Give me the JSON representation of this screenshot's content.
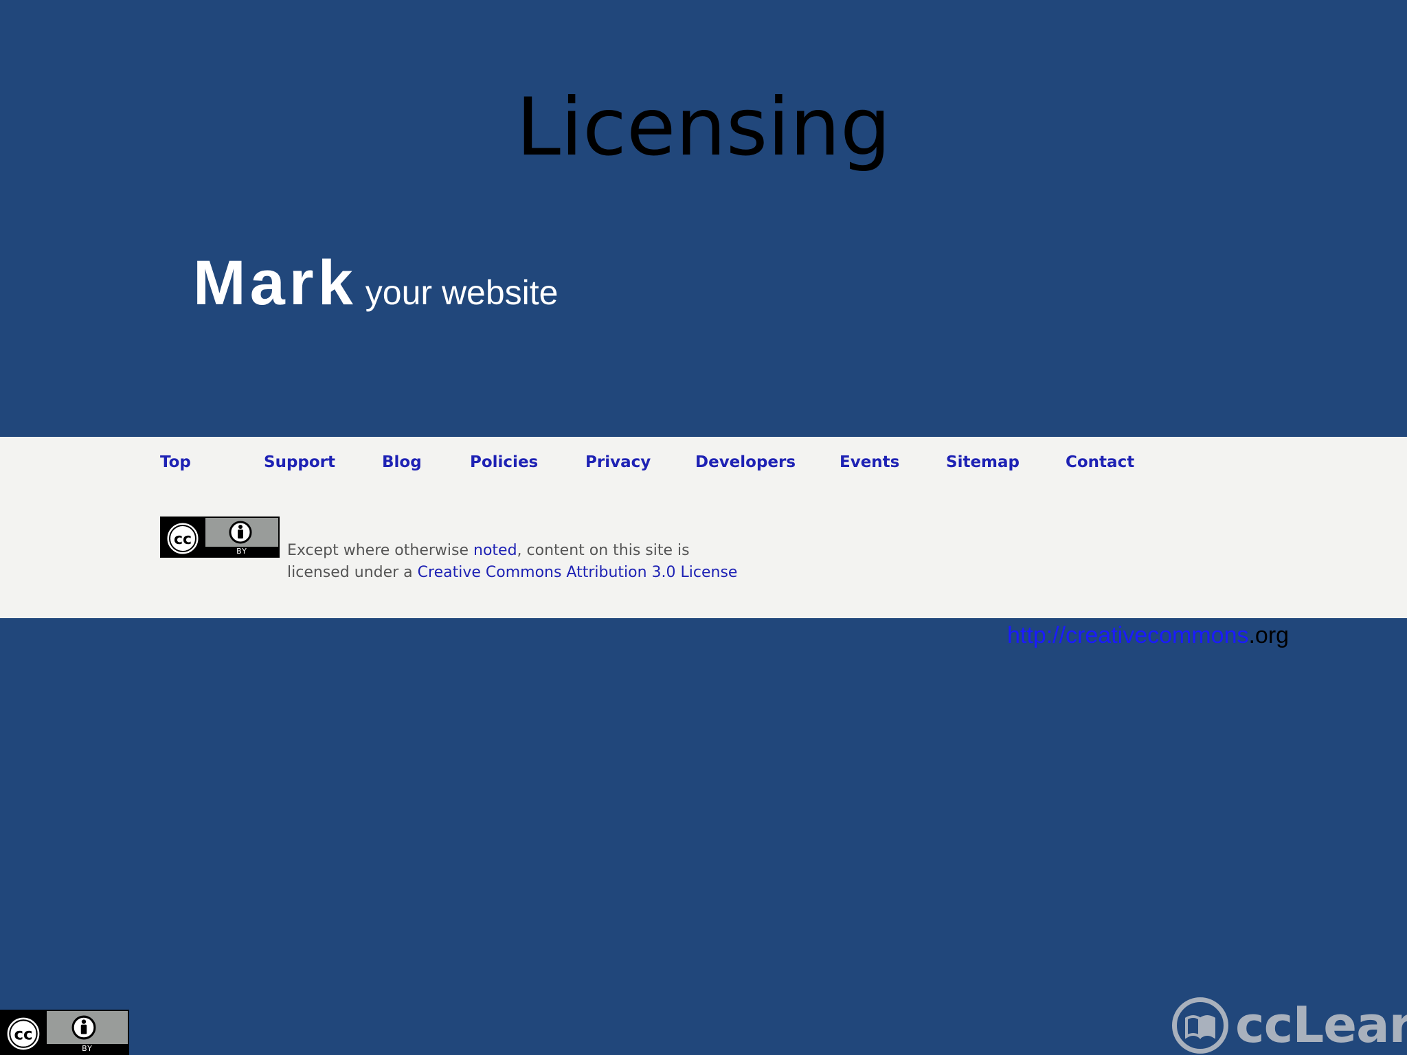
{
  "slide": {
    "title": "Licensing",
    "subtitle_big": "Mark",
    "subtitle_small": "your website"
  },
  "footer": {
    "nav": [
      "Top",
      "Support",
      "Blog",
      "Policies",
      "Privacy",
      "Developers",
      "Events",
      "Sitemap",
      "Contact"
    ],
    "license_prefix": "Except where otherwise ",
    "license_noted": "noted",
    "license_middle": ", content on this site is licensed under a ",
    "license_link": "Creative Commons Attribution 3.0 License",
    "badge_by": "BY"
  },
  "url": {
    "link_part": "http://creativecommons",
    "org_part": ".org"
  },
  "bottom_badge_by": "BY",
  "logo": {
    "word": "ccLearn"
  },
  "colors": {
    "background": "#21477b",
    "footer_band": "#f3f3f1",
    "nav_link": "#1e22b4",
    "url_link": "#1a1aff"
  }
}
